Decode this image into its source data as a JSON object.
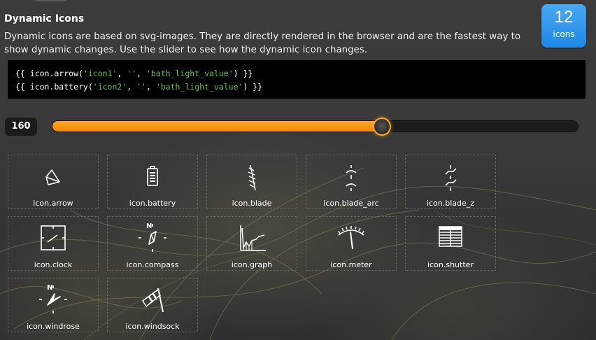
{
  "header": {
    "title": "Dynamic Icons",
    "description": "Dynamic icons are based on svg-images. They are directly rendered in the browser and are the fastest way to show dynamic changes. Use the slider to see how the dynamic icon changes."
  },
  "badge": {
    "count": "12",
    "label": "icons",
    "color": "#1e88e5"
  },
  "code": {
    "line1": {
      "pre": "{{ icon.arrow(",
      "arg1": "'icon1'",
      "sep1": ", ",
      "arg2": "''",
      "sep2": ", ",
      "arg3": "'bath_light_value'",
      "post": ") }}"
    },
    "line2": {
      "pre": "{{ icon.battery(",
      "arg1": "'icon2'",
      "sep1": ", ",
      "arg2": "''",
      "sep2": ", ",
      "arg3": "'bath_light_value'",
      "post": ") }}"
    }
  },
  "slider": {
    "value": "160",
    "min": 0,
    "max": 255,
    "fraction": 0.6275,
    "accent": "#f39c12"
  },
  "icons": [
    {
      "label": "icon.arrow",
      "icon": "arrow-icon"
    },
    {
      "label": "icon.battery",
      "icon": "battery-icon"
    },
    {
      "label": "icon.blade",
      "icon": "blade-icon"
    },
    {
      "label": "icon.blade_arc",
      "icon": "blade-arc-icon"
    },
    {
      "label": "icon.blade_z",
      "icon": "blade-z-icon"
    },
    {
      "label": "icon.clock",
      "icon": "clock-icon"
    },
    {
      "label": "icon.compass",
      "icon": "compass-icon",
      "text": "N"
    },
    {
      "label": "icon.graph",
      "icon": "graph-icon"
    },
    {
      "label": "icon.meter",
      "icon": "meter-icon"
    },
    {
      "label": "icon.shutter",
      "icon": "shutter-icon"
    },
    {
      "label": "icon.windrose",
      "icon": "windrose-icon",
      "text": "N"
    },
    {
      "label": "icon.windsock",
      "icon": "windsock-icon"
    }
  ]
}
